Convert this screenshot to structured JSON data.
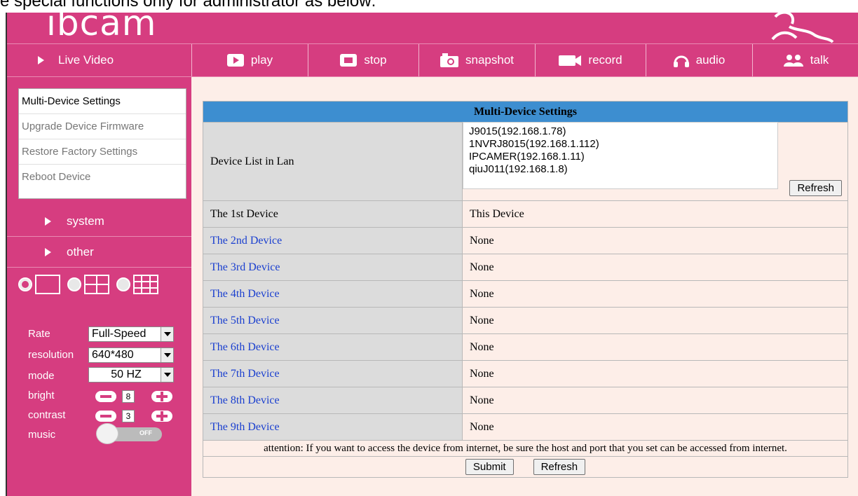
{
  "caption": "e special functions only for administrator as below:",
  "header": {
    "logo": "ibcam"
  },
  "navbar": {
    "live_video": "Live Video",
    "buttons": [
      "play",
      "stop",
      "snapshot",
      "record",
      "audio",
      "talk"
    ]
  },
  "menu": {
    "items": [
      "Multi-Device Settings",
      "Upgrade Device Firmware",
      "Restore Factory Settings",
      "Reboot Device"
    ]
  },
  "sidebar": {
    "system": "system",
    "other": "other",
    "rate_label": "Rate",
    "rate_value": "Full-Speed",
    "resolution_label": "resolution",
    "resolution_value": "640*480",
    "mode_label": "mode",
    "mode_value": "50 HZ",
    "bright_label": "bright",
    "bright_value": "8",
    "contrast_label": "contrast",
    "contrast_value": "3",
    "music_label": "music",
    "music_toggle": "OFF"
  },
  "settings": {
    "title": "Multi-Device Settings",
    "device_list_label": "Device List in Lan",
    "device_list": [
      "J9015(192.168.1.78)",
      "1NVRJ8015(192.168.1.112)",
      "IPCAMER(192.168.1.11)",
      "qiuJ011(192.168.1.8)"
    ],
    "refresh_label": "Refresh",
    "devices": [
      {
        "label": "The 1st Device",
        "value": "This Device"
      },
      {
        "label": "The 2nd Device",
        "value": "None"
      },
      {
        "label": "The 3rd Device",
        "value": "None"
      },
      {
        "label": "The 4th Device",
        "value": "None"
      },
      {
        "label": "The 5th Device",
        "value": "None"
      },
      {
        "label": "The 6th Device",
        "value": "None"
      },
      {
        "label": "The 7th Device",
        "value": "None"
      },
      {
        "label": "The 8th Device",
        "value": "None"
      },
      {
        "label": "The 9th Device",
        "value": "None"
      }
    ],
    "attention": "attention: If you want to access the device from internet, be sure the host and port that you set can be accessed from internet.",
    "submit_label": "Submit",
    "refresh2_label": "Refresh"
  },
  "colors": {
    "brand": "#d63d80",
    "header_blue": "#3d8ed0",
    "link": "#1a3fcf",
    "content_bg": "#fdeee8"
  }
}
